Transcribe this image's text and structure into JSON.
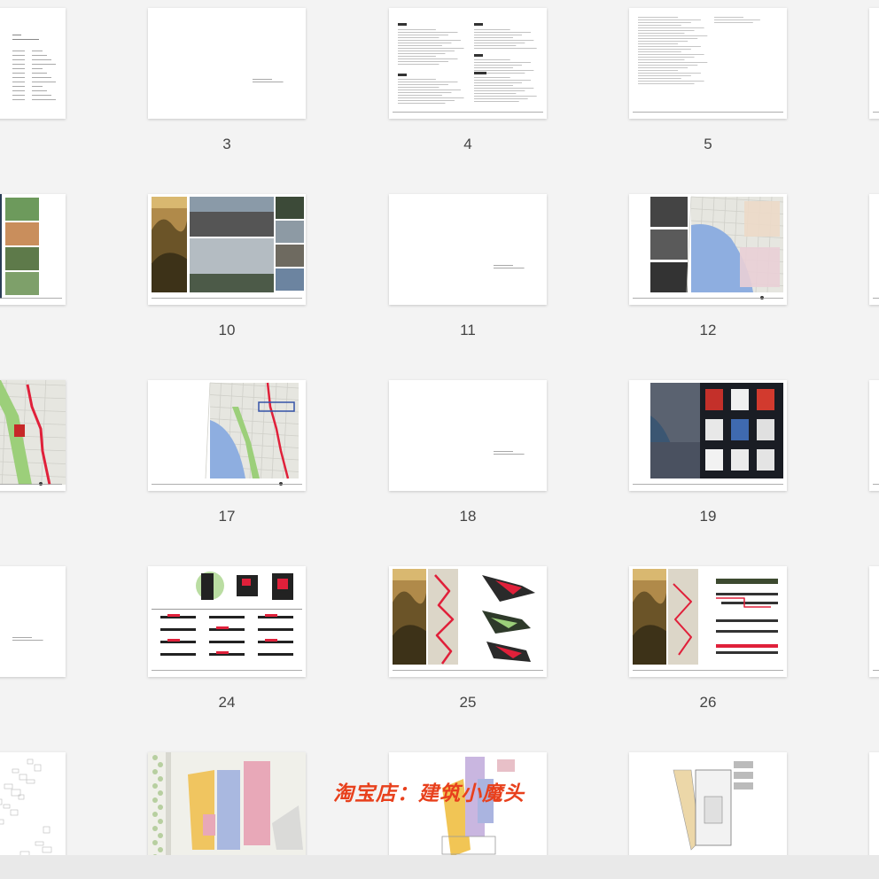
{
  "thumbnails": [
    {
      "page": "",
      "col": 0,
      "row": 0,
      "kind": "toc"
    },
    {
      "page": "3",
      "col": 1,
      "row": 0,
      "kind": "blank-note"
    },
    {
      "page": "4",
      "col": 2,
      "row": 0,
      "kind": "text-2col"
    },
    {
      "page": "5",
      "col": 3,
      "row": 0,
      "kind": "text-1col"
    },
    {
      "page": "",
      "col": 4,
      "row": 0,
      "kind": "blank"
    },
    {
      "page": "",
      "col": 0,
      "row": 1,
      "kind": "photo-grid"
    },
    {
      "page": "10",
      "col": 1,
      "row": 1,
      "kind": "photo-collage"
    },
    {
      "page": "11",
      "col": 2,
      "row": 1,
      "kind": "blank-note"
    },
    {
      "page": "12",
      "col": 3,
      "row": 1,
      "kind": "bw-map"
    },
    {
      "page": "",
      "col": 4,
      "row": 1,
      "kind": "blank"
    },
    {
      "page": "",
      "col": 0,
      "row": 2,
      "kind": "map-route"
    },
    {
      "page": "17",
      "col": 1,
      "row": 2,
      "kind": "map-half"
    },
    {
      "page": "18",
      "col": 2,
      "row": 2,
      "kind": "blank-note"
    },
    {
      "page": "19",
      "col": 3,
      "row": 2,
      "kind": "dark-models"
    },
    {
      "page": "",
      "col": 4,
      "row": 2,
      "kind": "blank"
    },
    {
      "page": "",
      "col": 0,
      "row": 3,
      "kind": "blank-note"
    },
    {
      "page": "24",
      "col": 1,
      "row": 3,
      "kind": "diagrams"
    },
    {
      "page": "25",
      "col": 2,
      "row": 3,
      "kind": "painting-axo"
    },
    {
      "page": "26",
      "col": 3,
      "row": 3,
      "kind": "painting-sections"
    },
    {
      "page": "",
      "col": 4,
      "row": 3,
      "kind": "blank"
    },
    {
      "page": "",
      "col": 0,
      "row": 4,
      "kind": "sketch-map"
    },
    {
      "page": "",
      "col": 1,
      "row": 4,
      "kind": "site-plan"
    },
    {
      "page": "",
      "col": 2,
      "row": 4,
      "kind": "plan-yellow"
    },
    {
      "page": "",
      "col": 3,
      "row": 4,
      "kind": "plan-gray"
    },
    {
      "page": "",
      "col": 4,
      "row": 4,
      "kind": "blank"
    }
  ],
  "watermark": "淘宝店：建筑小魔头",
  "colors": {
    "background": "#f3f3f3",
    "water": "#8eaee0",
    "route_red": "#e0203a",
    "green": "#9ccf7a",
    "dark": "#1a1d24",
    "watermark": "#e8401c"
  }
}
